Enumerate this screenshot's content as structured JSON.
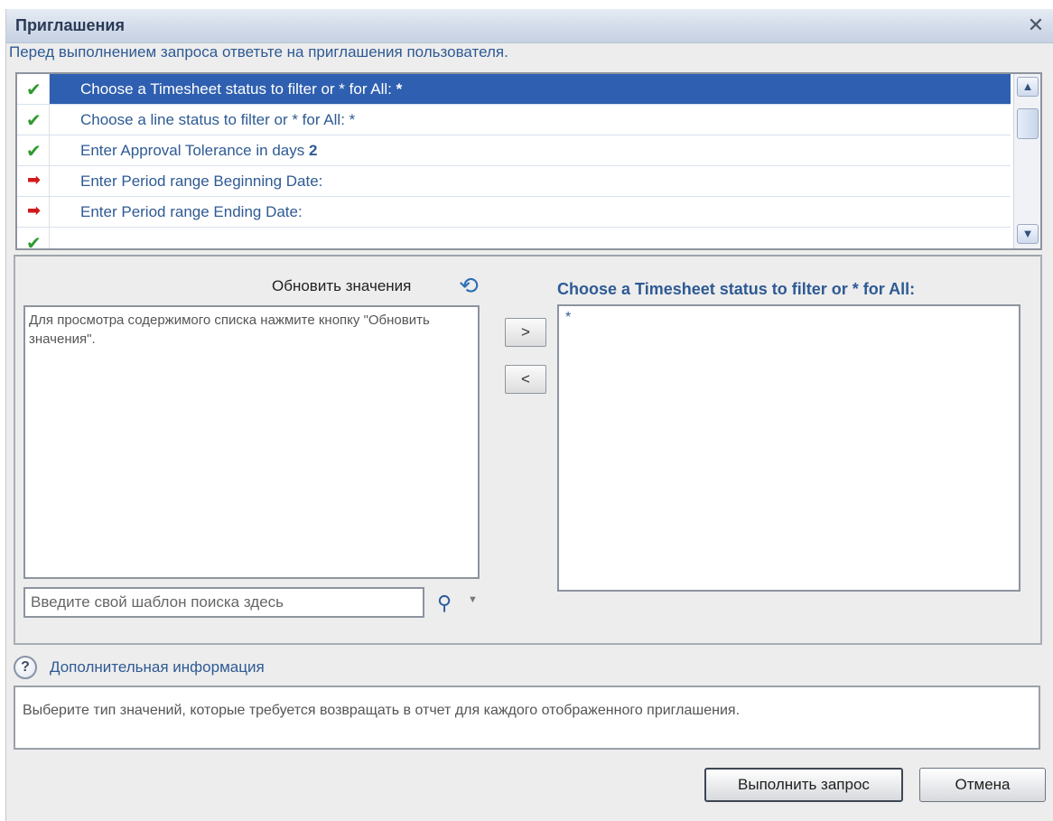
{
  "dialog": {
    "title": "Приглашения",
    "close_glyph": "✕",
    "instruction": "Перед выполнением запроса ответьте на приглашения пользователя."
  },
  "prompt_list": {
    "items": [
      {
        "status": "answered",
        "icon": "check-icon",
        "text": "Choose a Timesheet status to filter or * for All:",
        "value": "*",
        "selected": true
      },
      {
        "status": "answered",
        "icon": "check-icon",
        "text": "Choose a line status to filter or * for All:",
        "value": "*",
        "selected": false
      },
      {
        "status": "answered",
        "icon": "check-icon",
        "text": "Enter Approval Tolerance in days",
        "value": "2",
        "selected": false
      },
      {
        "status": "required",
        "icon": "red-arrow-icon",
        "text": "Enter Period range Beginning Date:",
        "value": "",
        "selected": false
      },
      {
        "status": "required",
        "icon": "red-arrow-icon",
        "text": "Enter Period range Ending Date:",
        "value": "",
        "selected": false
      }
    ]
  },
  "values_panel": {
    "refresh_label": "Обновить значения",
    "available_hint": "Для просмотра содержимого списка нажмите кнопку \"Обновить значения\".",
    "add_label": ">",
    "remove_label": "<",
    "selected_title": "Choose a Timesheet status to filter or * for All:",
    "selected_values": [
      "*"
    ],
    "search_placeholder": "Введите свой шаблон поиска здесь"
  },
  "info": {
    "link_label": "Дополнительная информация",
    "description": "Выберите тип значений, которые требуется возвращать в отчет для каждого отображенного приглашения."
  },
  "buttons": {
    "run": "Выполнить запрос",
    "cancel": "Отмена"
  },
  "colors": {
    "accent": "#2f5fb0",
    "link_text": "#2e5a94",
    "check": "#2f9a2f",
    "arrow": "#d11a1a"
  }
}
